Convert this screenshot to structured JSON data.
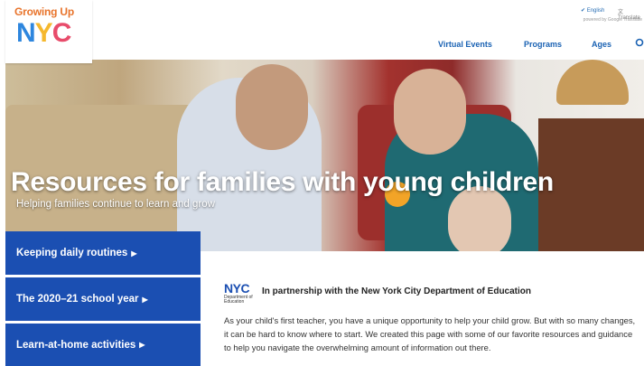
{
  "logo": {
    "line1": "Growing Up",
    "line2_n": "N",
    "line2_y": "Y",
    "line2_c": "C"
  },
  "language": {
    "english": "English",
    "translate": "Translate",
    "powered_by": "powered by Google Translate"
  },
  "nav": {
    "virtual_events": "Virtual Events",
    "programs": "Programs",
    "ages": "Ages"
  },
  "hero": {
    "title": "Resources for families with young children",
    "subtitle": "Helping families continue to learn and grow"
  },
  "sidebar": {
    "items": [
      {
        "label": "Keeping daily routines"
      },
      {
        "label": "The 2020–21 school year"
      },
      {
        "label": "Learn-at-home activities"
      }
    ]
  },
  "doe_logo": {
    "nyc": "NYC",
    "line1": "Department of",
    "line2": "Education"
  },
  "content": {
    "partner_text": "In partnership with the New York City Department of Education",
    "paragraph": "As your child's first teacher, you have a unique opportunity to help your child grow. But with so many changes, it can be hard to know where to start. We created this page with some of our favorite resources and guidance to help you navigate the overwhelming amount of information out there."
  },
  "colors": {
    "nav_blue": "#1a62b3",
    "button_blue": "#1b4fb2"
  },
  "icons": {
    "search": "search-icon",
    "check": "check-icon",
    "translate": "translate-icon",
    "arrow": "triangle-right-icon"
  }
}
